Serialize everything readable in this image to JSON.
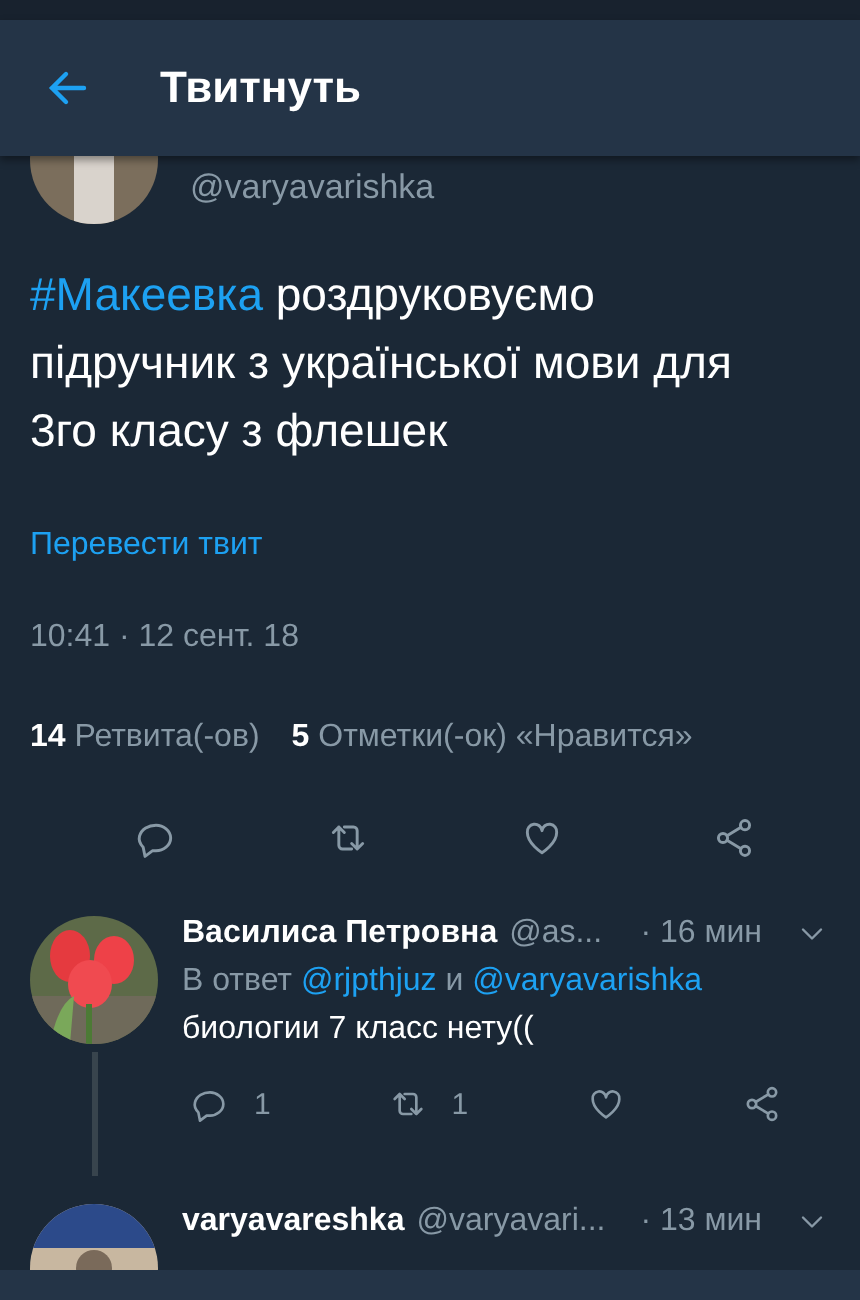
{
  "header": {
    "title": "Твитнуть"
  },
  "tweet": {
    "handle": "@varyavarishka",
    "hashtag": "#Макеевка",
    "text": "роздруковуємо підручник з української мови для 3го класу з флешек",
    "translate": "Перевести твит",
    "timestamp": "10:41 · 12 сент. 18",
    "stats": [
      {
        "count": "14",
        "label": "Ретвита(-ов)"
      },
      {
        "count": "5",
        "label": "Отметки(-ок) «Нравится»"
      }
    ]
  },
  "replies": [
    {
      "name": "Василиса Петровна",
      "handle": "@as...",
      "time": "· 16 мин",
      "reply_prefix": "В ответ",
      "mentions": [
        "@rjpthjuz",
        "@varyavarishka"
      ],
      "joiner": "и",
      "text": "биологии 7 класс нету((",
      "reply_count": "1",
      "retweet_count": "1"
    },
    {
      "name": "varyavareshka",
      "handle": "@varyavari...",
      "time": "· 13 мин"
    }
  ]
}
